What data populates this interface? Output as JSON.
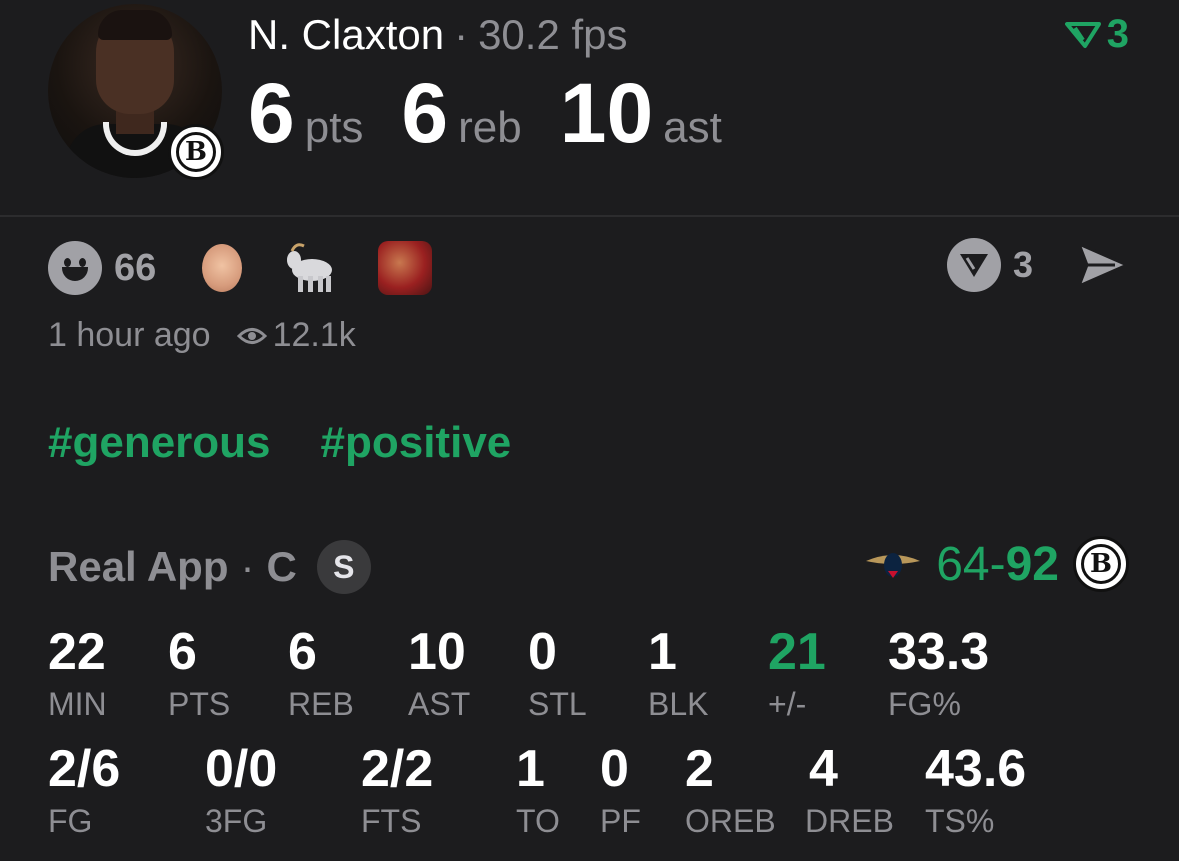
{
  "header": {
    "player_name": "N. Claxton",
    "separator": "·",
    "fps": "30.2 fps",
    "fantasy_count": "3",
    "team_logo_letter": "B",
    "big_stats": [
      {
        "value": "6",
        "unit": "pts"
      },
      {
        "value": "6",
        "unit": "reb"
      },
      {
        "value": "10",
        "unit": "ast"
      }
    ]
  },
  "reactions": {
    "smile_count": "66",
    "right_count": "3",
    "icons": [
      "smile-icon",
      "player-face-emoji",
      "goat-emoji",
      "jordan-emoji",
      "v-logo-icon",
      "send-icon"
    ]
  },
  "meta": {
    "time_ago": "1 hour ago",
    "views": "12.1k"
  },
  "tags": [
    "#generous",
    "#positive"
  ],
  "game": {
    "source": "Real App",
    "separator": "·",
    "position": "C",
    "badge": "S",
    "score_away": "64-",
    "score_home": "92",
    "home_logo_letter": "B"
  },
  "stats_row1": [
    {
      "value": "22",
      "label": "MIN"
    },
    {
      "value": "6",
      "label": "PTS"
    },
    {
      "value": "6",
      "label": "REB"
    },
    {
      "value": "10",
      "label": "AST"
    },
    {
      "value": "0",
      "label": "STL"
    },
    {
      "value": "1",
      "label": "BLK"
    },
    {
      "value": "21",
      "label": "+/-"
    },
    {
      "value": "33.3",
      "label": "FG%"
    }
  ],
  "stats_row2": [
    {
      "value": "2/6",
      "label": "FG"
    },
    {
      "value": "0/0",
      "label": "3FG"
    },
    {
      "value": "2/2",
      "label": "FTS"
    },
    {
      "value": "1",
      "label": "TO"
    },
    {
      "value": "0",
      "label": "PF"
    },
    {
      "value": "2",
      "label": "OREB"
    },
    {
      "value": "4",
      "label": "DREB"
    },
    {
      "value": "43.6",
      "label": "TS%"
    }
  ],
  "colors": {
    "background": "#1c1c1e",
    "accent_green": "#1fa463",
    "muted": "#8e8e93"
  }
}
